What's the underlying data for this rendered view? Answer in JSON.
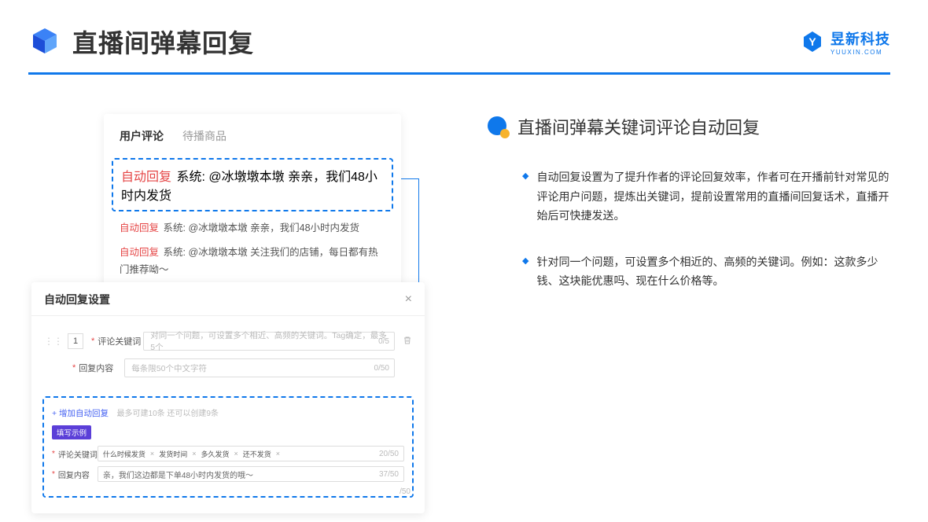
{
  "header": {
    "title": "直播间弹幕回复",
    "brand_name": "昱新科技",
    "brand_url": "YUUXIN.COM"
  },
  "comments_card": {
    "tab_active": "用户评论",
    "tab_inactive": "待播商品",
    "reply_tag": "自动回复",
    "row1_system": "系统:",
    "row1_text": "@冰墩墩本墩 亲亲，我们48小时内发货",
    "row2_system": "系统:",
    "row2_text": "@冰墩墩本墩 亲亲，我们48小时内发货",
    "row3_system": "系统:",
    "row3_text": "@冰墩墩本墩 关注我们的店铺，每日都有热门推荐呦～"
  },
  "settings_card": {
    "title": "自动回复设置",
    "seq": "1",
    "field_keyword_label": "评论关键词",
    "field_keyword_placeholder": "对同一个问题，可设置多个相近、高频的关键词。Tag确定，最多5个",
    "field_keyword_count": "0/5",
    "field_content_label": "回复内容",
    "field_content_placeholder": "每条限50个中文字符",
    "field_content_count": "0/50",
    "add_link": "+ 增加自动回复",
    "add_hint": "最多可建10条 还可以创建9条",
    "example_tag": "填写示例",
    "ex_keyword_label": "评论关键词",
    "ex_chip1": "什么时候发货",
    "ex_chip2": "发货时间",
    "ex_chip3": "多久发货",
    "ex_chip4": "还不发货",
    "ex_keyword_count": "20/50",
    "ex_content_label": "回复内容",
    "ex_content_text": "亲，我们这边都是下单48小时内发货的哦～",
    "ex_content_count": "37/50",
    "outer_count": "/50"
  },
  "right": {
    "title": "直播间弹幕关键词评论自动回复",
    "bullet1": "自动回复设置为了提升作者的评论回复效率，作者可在开播前针对常见的评论用户问题，提炼出关键词，提前设置常用的直播间回复话术，直播开始后可快捷发送。",
    "bullet2": "针对同一个问题，可设置多个相近的、高频的关键词。例如：这款多少钱、这块能优惠吗、现在什么价格等。"
  }
}
